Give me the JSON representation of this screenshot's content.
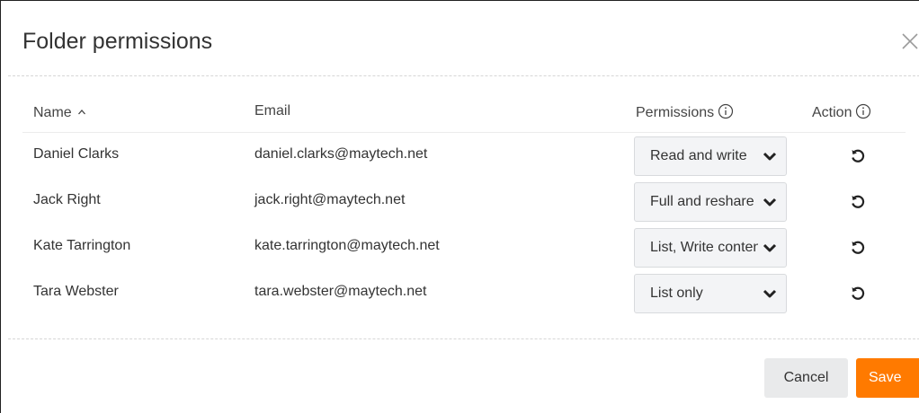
{
  "dialog": {
    "title": "Folder permissions"
  },
  "table": {
    "columns": {
      "name": "Name",
      "email": "Email",
      "permissions": "Permissions",
      "action": "Action"
    },
    "rows": [
      {
        "name": "Daniel Clarks",
        "email": "daniel.clarks@maytech.net",
        "permission": "Read and write"
      },
      {
        "name": "Jack Right",
        "email": "jack.right@maytech.net",
        "permission": "Full and reshare"
      },
      {
        "name": "Kate Tarrington",
        "email": "kate.tarrington@maytech.net",
        "permission": "List, Write content"
      },
      {
        "name": "Tara Webster",
        "email": "tara.webster@maytech.net",
        "permission": "List only"
      }
    ]
  },
  "footer": {
    "cancel_label": "Cancel",
    "save_label": "Save"
  },
  "colors": {
    "accent": "#ff7a00",
    "select_bg": "#f3f4f6"
  },
  "icons": {
    "close": "close-icon",
    "sort": "chevron-up-icon",
    "info": "info-icon",
    "dropdown": "chevron-down-icon",
    "reset": "reset-icon"
  }
}
